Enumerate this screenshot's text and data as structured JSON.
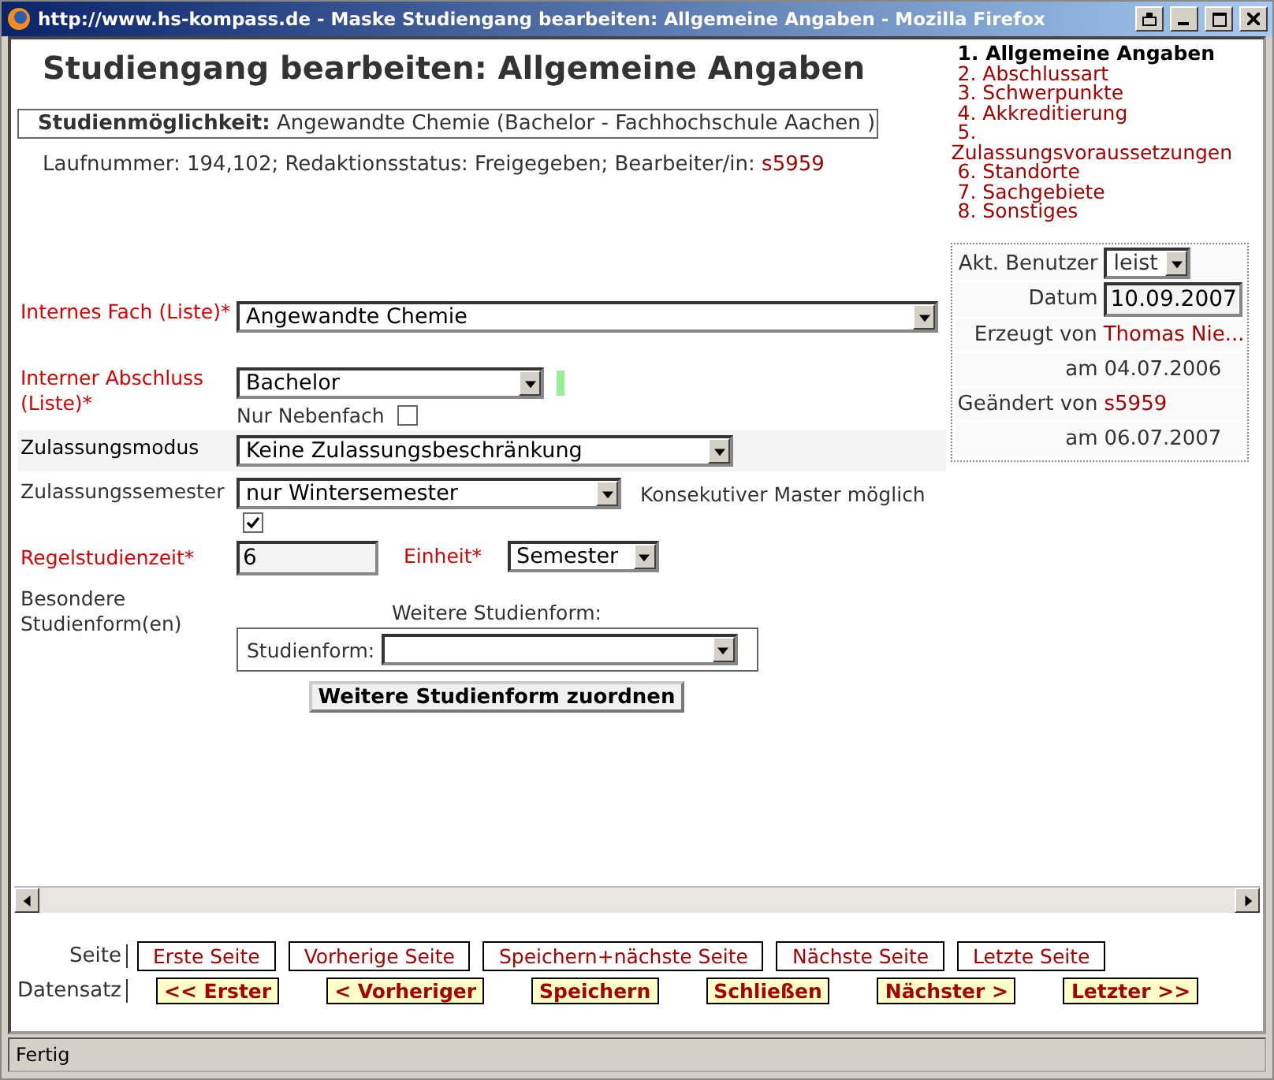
{
  "window": {
    "title": "http://www.hs-kompass.de - Maske Studiengang bearbeiten: Allgemeine Angaben - Mozilla Firefox"
  },
  "heading": "Studiengang bearbeiten: Allgemeine Angaben",
  "studienmoeglichkeit": {
    "label": "Studienmöglichkeit:",
    "value": "Angewandte Chemie (Bachelor - Fachhochschule Aachen )"
  },
  "info": {
    "text": "Laufnummer: 194,102; Redaktionsstatus: Freigegeben; Bearbeiter/in:",
    "user": "s5959"
  },
  "nav": [
    {
      "label": "1. Allgemeine Angaben",
      "selected": true
    },
    {
      "label": "2. Abschlussart",
      "selected": false
    },
    {
      "label": "3. Schwerpunkte",
      "selected": false
    },
    {
      "label": "4. Akkreditierung",
      "selected": false
    },
    {
      "label": "5.",
      "selected": false
    },
    {
      "label": "Zulassungsvoraussetzungen",
      "selected": false
    },
    {
      "label": "6. Standorte",
      "selected": false
    },
    {
      "label": "7. Sachgebiete",
      "selected": false
    },
    {
      "label": "8. Sonstiges",
      "selected": false
    }
  ],
  "form": {
    "internes_fach": {
      "label": "Internes Fach (Liste)*",
      "value": "Angewandte Chemie"
    },
    "interner_abschluss": {
      "label": "Interner Abschluss (Liste)*",
      "value": "Bachelor"
    },
    "nur_nebenfach": {
      "label": "Nur Nebenfach",
      "checked": false
    },
    "zulassungsmodus": {
      "label": "Zulassungsmodus",
      "value": "Keine Zulassungsbeschränkung"
    },
    "zulassungssemester": {
      "label": "Zulassungssemester",
      "value": "nur Wintersemester"
    },
    "konsekutiv": {
      "label": "Konsekutiver Master möglich",
      "checked": true
    },
    "regelstudienzeit": {
      "label": "Regelstudienzeit*",
      "value": "6"
    },
    "einheit": {
      "label": "Einheit*",
      "value": "Semester"
    },
    "studienform": {
      "label": "Besondere Studienform(en)",
      "caption": "Weitere Studienform:",
      "field_label": "Studienform:",
      "button": "Weitere Studienform zuordnen"
    }
  },
  "meta": {
    "benutzer": {
      "label": "Akt. Benutzer",
      "value": "leist"
    },
    "datum": {
      "label": "Datum",
      "value": "10.09.2007"
    },
    "rows": [
      {
        "label": "Erzeugt von",
        "value": "Thomas Nie...",
        "kind": "link"
      },
      {
        "label": "am",
        "value": "04.07.2006",
        "kind": "plain"
      },
      {
        "label": "Geändert von",
        "value": "s5959",
        "kind": "link"
      },
      {
        "label": "am",
        "value": "06.07.2007",
        "kind": "plain"
      }
    ]
  },
  "page_nav": {
    "label": "Seite",
    "buttons": [
      "Erste Seite",
      "Vorherige Seite",
      "Speichern+nächste Seite",
      "Nächste Seite",
      "Letzte Seite"
    ]
  },
  "record_nav": {
    "label": "Datensatz",
    "buttons": [
      "<< Erster",
      "< Vorheriger",
      "Speichern",
      "Schließen",
      "Nächster >",
      "Letzter >>"
    ]
  },
  "status_bar": "Fertig"
}
